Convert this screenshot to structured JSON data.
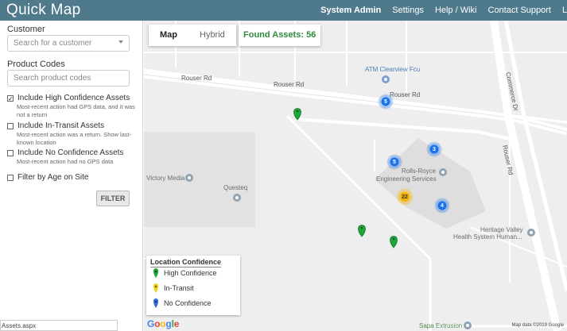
{
  "app": {
    "title": "Quick Map"
  },
  "topnav": {
    "items": [
      "System Admin",
      "Settings",
      "Help / Wiki",
      "Contact Support"
    ],
    "cut_item": "L"
  },
  "sidebar": {
    "customer_label": "Customer",
    "customer_placeholder": "Search for a customer",
    "product_label": "Product Codes",
    "product_placeholder": "Search product codes",
    "options": [
      {
        "title": "Include High Confidence Assets",
        "desc": "Most-recent action had GPS data, and it was not a return",
        "checked": true
      },
      {
        "title": "Include In-Transit Assets",
        "desc": "Most-recent action was a return. Show last-known location",
        "checked": false
      },
      {
        "title": "Include No Confidence Assets",
        "desc": "Most-recent action had no GPS data",
        "checked": false
      },
      {
        "title": "Filter by Age on Site",
        "desc": "",
        "checked": false
      }
    ],
    "filter_label": "FILTER",
    "status_url": "Assets.aspx"
  },
  "map": {
    "tabs": [
      "Map",
      "Hybrid"
    ],
    "found_label": "Found Assets:",
    "found_count": "56",
    "roads": [
      "Rouser Rd",
      "Rouser Rd",
      "Rouser Rd",
      "Rouser Rd",
      "Commerce Dr"
    ],
    "places": [
      "ATM Clearview Fcu",
      "Victory Media",
      "Questeq",
      "Rolls-Royce",
      "Engineering Services",
      "Heritage Valley",
      "Health System Human...",
      "Sapa Extrusion"
    ],
    "clusters": [
      {
        "count": "5",
        "color": "#1a73e8"
      },
      {
        "count": "3",
        "color": "#1a73e8"
      },
      {
        "count": "5",
        "color": "#1a73e8"
      },
      {
        "count": "22",
        "color": "#f4b400"
      },
      {
        "count": "4",
        "color": "#1a73e8"
      }
    ],
    "legend": {
      "title": "Location Confidence",
      "items": [
        {
          "label": "High Confidence",
          "color": "#1fa83a"
        },
        {
          "label": "In-Transit",
          "color": "#f2d21b"
        },
        {
          "label": "No Confidence",
          "color": "#2f6fd6"
        }
      ]
    },
    "google_logo": "Google",
    "map_data": "Map data ©2019 Google"
  }
}
